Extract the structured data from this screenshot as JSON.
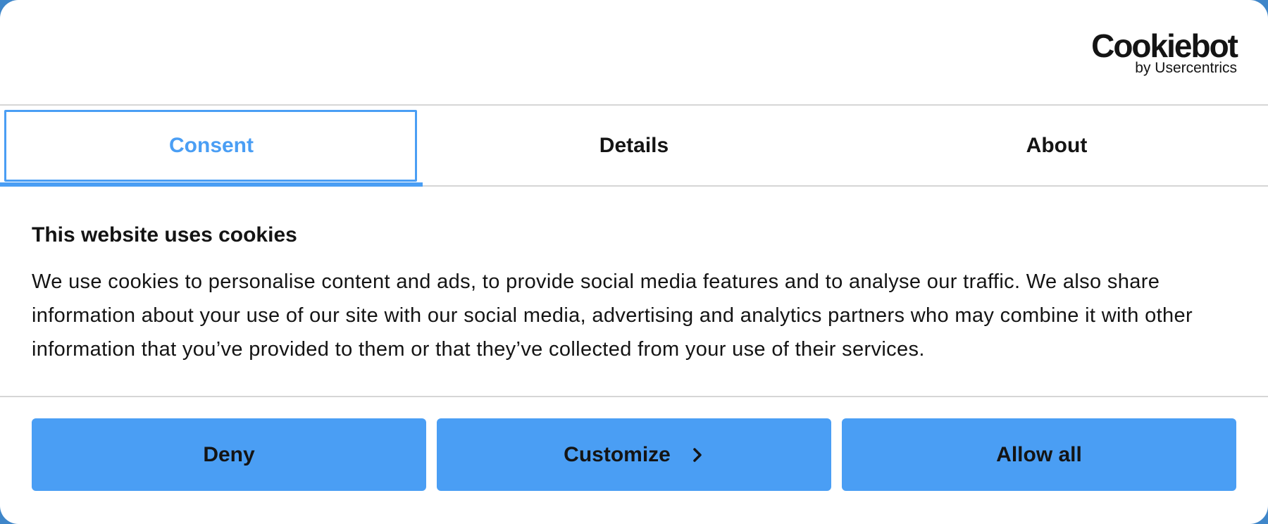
{
  "logo": {
    "wordmark": "Cookiebot",
    "subtitle": "by Usercentrics"
  },
  "tabs": [
    {
      "label": "Consent",
      "active": true
    },
    {
      "label": "Details",
      "active": false
    },
    {
      "label": "About",
      "active": false
    }
  ],
  "content": {
    "title": "This website uses cookies",
    "body": "We use cookies to personalise content and ads, to provide social media features and to analyse our traffic. We also share information about your use of our site with our social media, advertising and analytics partners who may combine it with other information that you’ve provided to them or that they’ve collected from your use of their services."
  },
  "buttons": {
    "deny": "Deny",
    "customize": "Customize",
    "allow_all": "Allow all"
  },
  "icons": {
    "customize": "chevron-right-icon"
  },
  "colors": {
    "accent": "#4a9ef4",
    "text": "#141414",
    "divider": "#d6d6d6",
    "backdrop": "#3f86c9"
  }
}
